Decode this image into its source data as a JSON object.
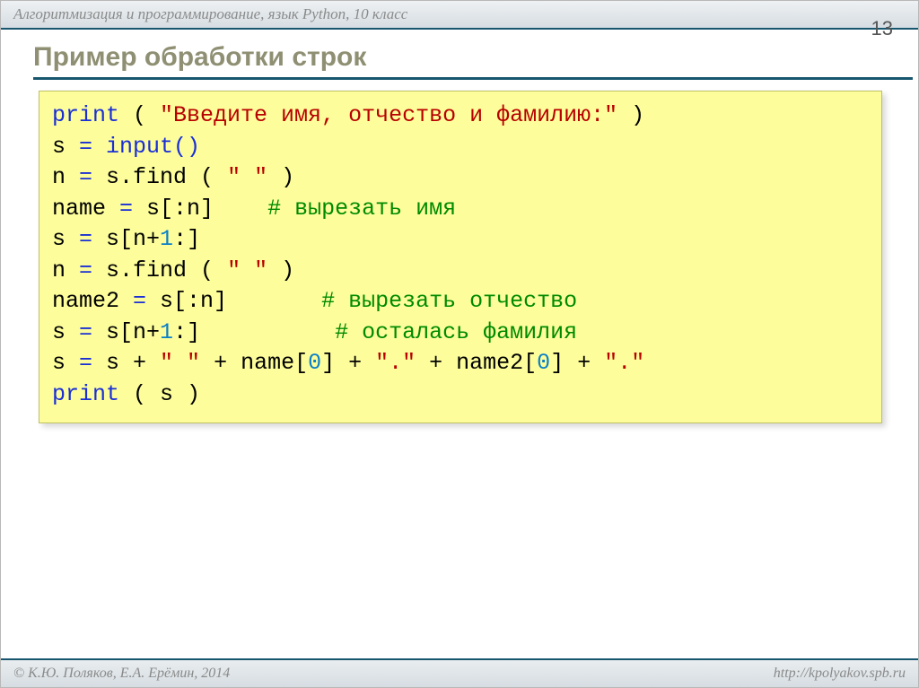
{
  "header": {
    "course": "Алгоритмизация и программирование, язык Python, 10 класс",
    "slide_number": "13"
  },
  "title": "Пример обработки строк",
  "code": {
    "l1_kw": "print",
    "l1_paren1": " ( ",
    "l1_str": "\"Введите имя, отчество и фамилию:\"",
    "l1_paren2": " )",
    "l2_a": "s",
    "l2_eq": " = ",
    "l2_b": "input()",
    "l3_a": "n",
    "l3_eq": " = ",
    "l3_b": "s.find",
    "l3_paren1": " ( ",
    "l3_str": "\" \"",
    "l3_paren2": " )",
    "l4_a": "name",
    "l4_eq": " = ",
    "l4_b": "s[:n]    ",
    "l4_cmt": "# вырезать имя",
    "l5_a": "s",
    "l5_eq": " = ",
    "l5_b": "s[n+",
    "l5_num": "1",
    "l5_c": ":]",
    "l6_a": "n",
    "l6_eq": " = ",
    "l6_b": "s.find",
    "l6_paren1": " ( ",
    "l6_str": "\" \"",
    "l6_paren2": " )",
    "l7_a": "name2",
    "l7_eq": " = ",
    "l7_b": "s[:n]       ",
    "l7_cmt": "# вырезать отчество",
    "l8_a": "s",
    "l8_eq": " = ",
    "l8_b": "s[n+",
    "l8_num": "1",
    "l8_c": ":]          ",
    "l8_cmt": "# осталась фамилия",
    "l9_a": "s",
    "l9_eq": " = ",
    "l9_b": "s + ",
    "l9_s1": "\" \"",
    "l9_c": " + name[",
    "l9_n1": "0",
    "l9_d": "] + ",
    "l9_s2": "\".\"",
    "l9_e": " + name2[",
    "l9_n2": "0",
    "l9_f": "] + ",
    "l9_s3": "\".\"",
    "l10_kw": "print",
    "l10_b": " ( s )"
  },
  "footer": {
    "left": "© К.Ю. Поляков, Е.А. Ерёмин, 2014",
    "right": "http://kpolyakov.spb.ru"
  }
}
